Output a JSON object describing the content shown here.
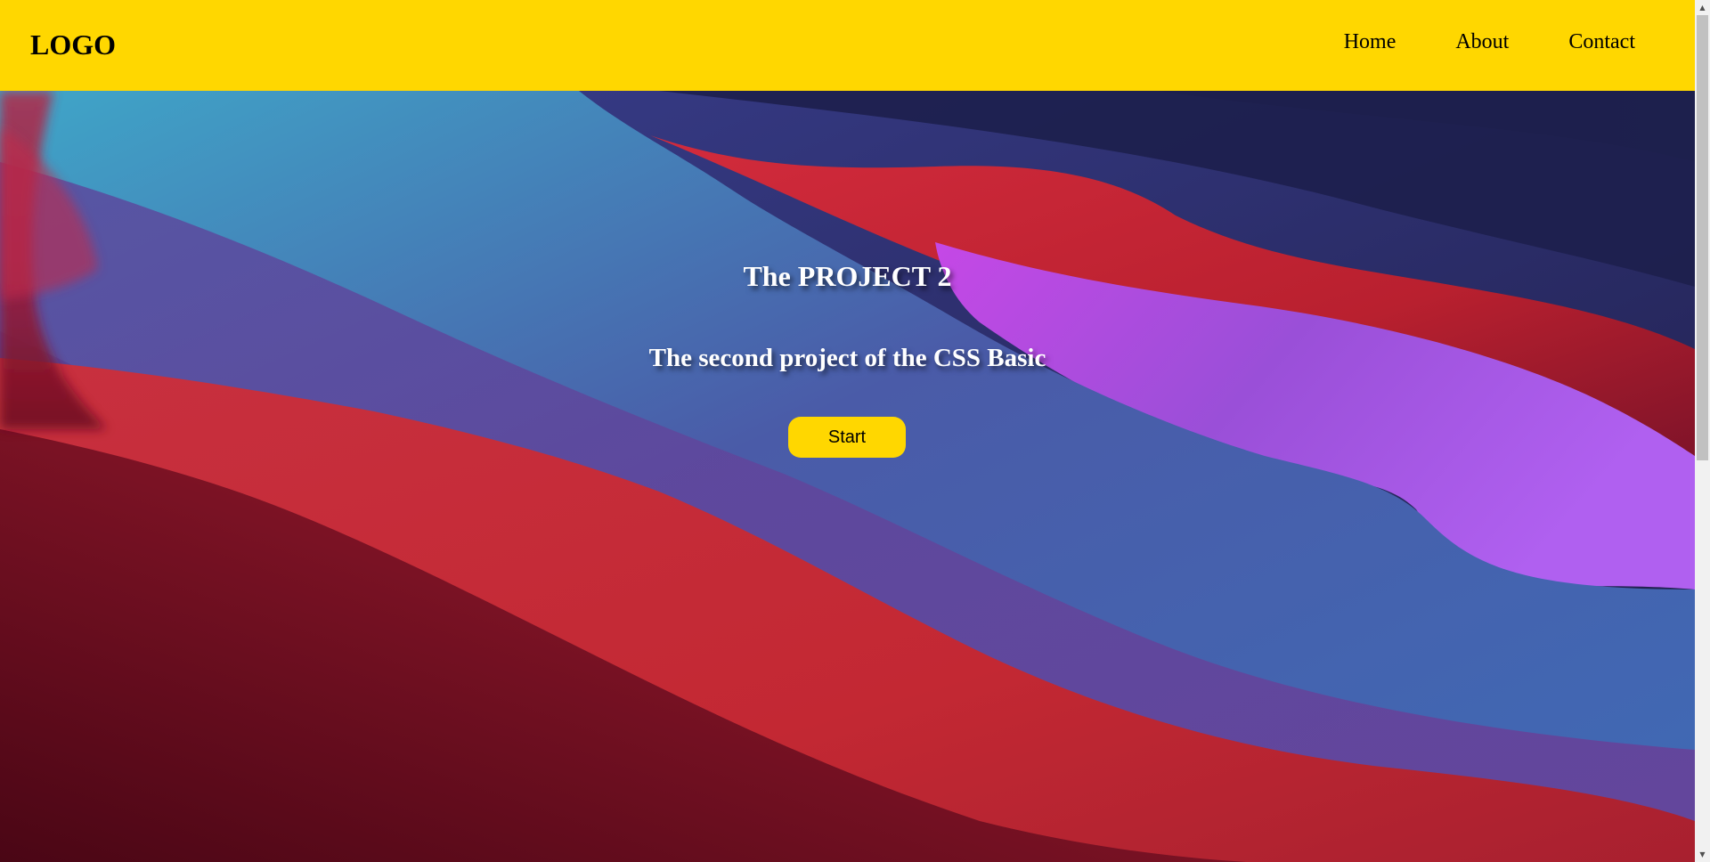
{
  "header": {
    "logo": "LOGO",
    "nav": [
      {
        "label": "Home"
      },
      {
        "label": "About"
      },
      {
        "label": "Contact"
      }
    ]
  },
  "hero": {
    "title": "The PROJECT 2",
    "subtitle": "The second project of the CSS Basic",
    "button_label": "Start"
  },
  "scrollbar": {
    "up_icon": "▲",
    "down_icon": "▼"
  },
  "colors": {
    "header_bg": "#ffd700",
    "button_bg": "#ffd700",
    "text_light": "#ffffff"
  }
}
